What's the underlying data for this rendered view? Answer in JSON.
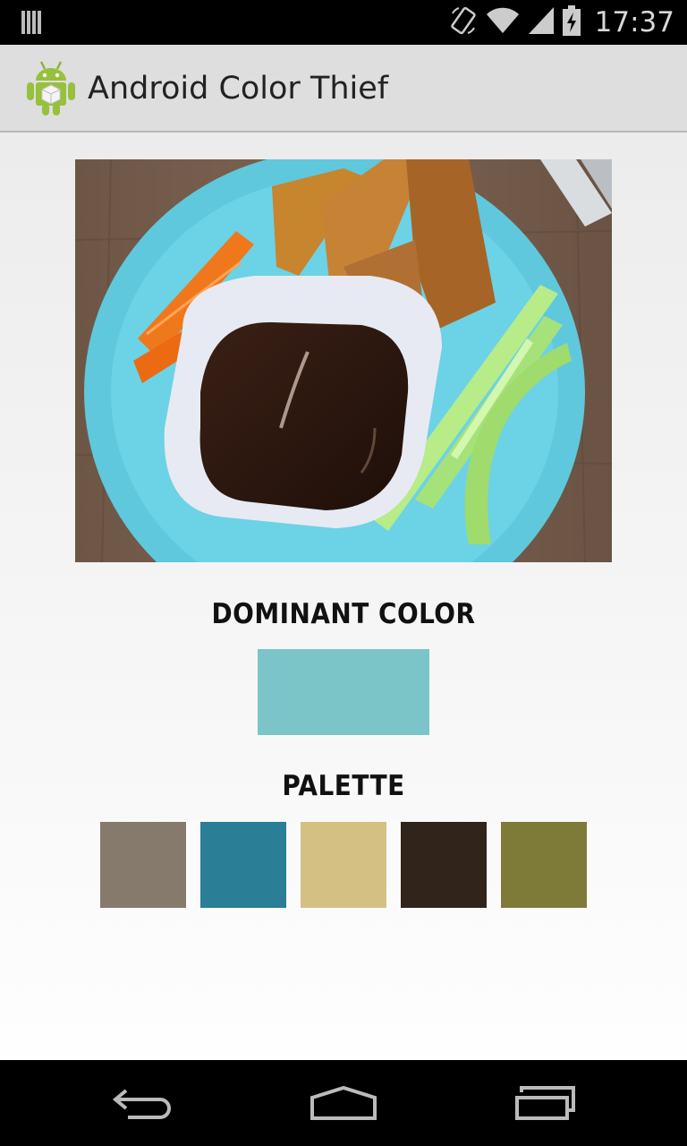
{
  "status_bar": {
    "time": "17:37",
    "icons": [
      "notification-icon",
      "rotation-lock-icon",
      "wifi-icon",
      "signal-icon",
      "battery-charging-icon"
    ]
  },
  "app": {
    "title": "Android Color Thief",
    "icon": "android-robot-icon"
  },
  "main": {
    "image": "food-plate-photo",
    "dominant": {
      "heading": "DOMINANT COLOR",
      "color": "#7bc5c9"
    },
    "palette": {
      "heading": "PALETTE",
      "colors": [
        "#857a6b",
        "#2a7e96",
        "#d5c084",
        "#31241a",
        "#7e7a38"
      ]
    }
  },
  "nav_bar": {
    "buttons": [
      "back-icon",
      "home-icon",
      "recents-icon"
    ]
  }
}
